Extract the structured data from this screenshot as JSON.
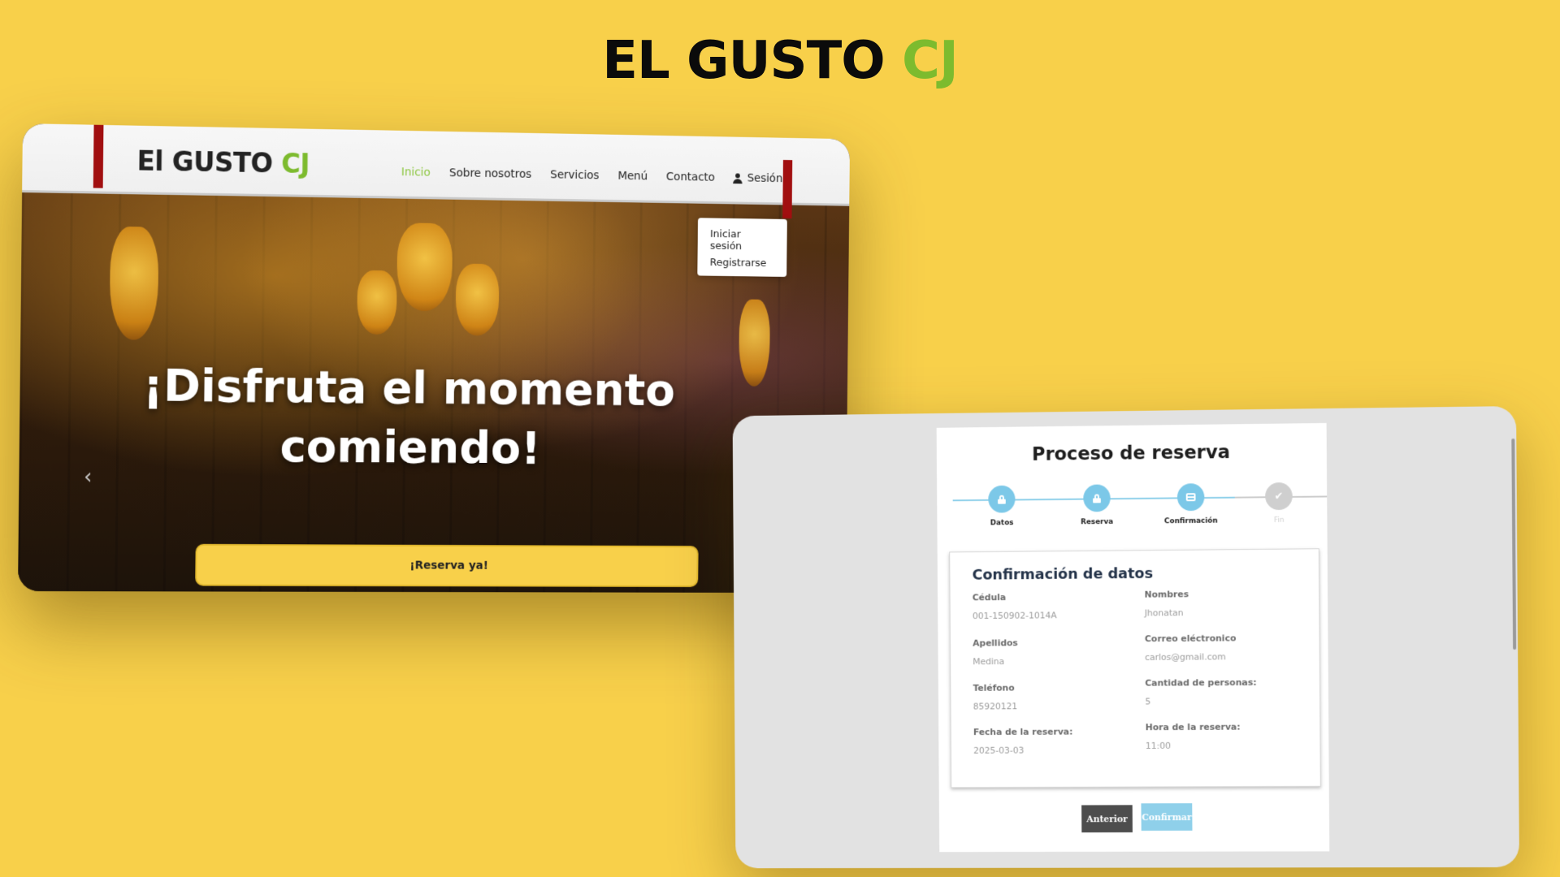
{
  "brand": {
    "title_main": "EL GUSTO",
    "title_accent": "CJ",
    "accent_color": "#7dbb2e",
    "background_color": "#f8d04a"
  },
  "site": {
    "logo_main": "El GUSTO",
    "logo_accent": "CJ",
    "nav": {
      "items": [
        {
          "label": "Inicio",
          "active": true
        },
        {
          "label": "Sobre nosotros",
          "active": false
        },
        {
          "label": "Servicios",
          "active": false
        },
        {
          "label": "Menú",
          "active": false
        },
        {
          "label": "Contacto",
          "active": false
        }
      ],
      "session_label": "Sesión",
      "session_icon": "user-icon",
      "dropdown_items": [
        "Iniciar sesión",
        "Registrarse"
      ]
    },
    "hero": {
      "headline_line1": "¡Disfruta el momento",
      "headline_line2": "comiendo!",
      "cta_label": "¡Reserva ya!",
      "prev_icon": "chevron-left-icon"
    }
  },
  "reservation": {
    "title": "Proceso de reserva",
    "steps": [
      {
        "label": "Datos",
        "icon": "lock-icon",
        "state": "active"
      },
      {
        "label": "Reserva",
        "icon": "lock-icon",
        "state": "active"
      },
      {
        "label": "Confirmación",
        "icon": "card-icon",
        "state": "active"
      },
      {
        "label": "Fin",
        "icon": "check-icon",
        "state": "pending"
      }
    ],
    "confirmation": {
      "title": "Confirmación de datos",
      "fields": {
        "cedula": {
          "label": "Cédula",
          "value": "001-150902-1014A"
        },
        "nombres": {
          "label": "Nombres",
          "value": "Jhonatan"
        },
        "apellidos": {
          "label": "Apellidos",
          "value": "Medina"
        },
        "correo": {
          "label": "Correo eléctronico",
          "value": "carlos@gmail.com"
        },
        "telefono": {
          "label": "Teléfono",
          "value": "85920121"
        },
        "cantidad": {
          "label": "Cantidad de personas:",
          "value": "5"
        },
        "fecha": {
          "label": "Fecha de la reserva:",
          "value": "2025-03-03"
        },
        "hora": {
          "label": "Hora de la reserva:",
          "value": "11:00"
        }
      }
    },
    "buttons": {
      "previous": "Anterior",
      "confirm": "Confirmar"
    }
  }
}
